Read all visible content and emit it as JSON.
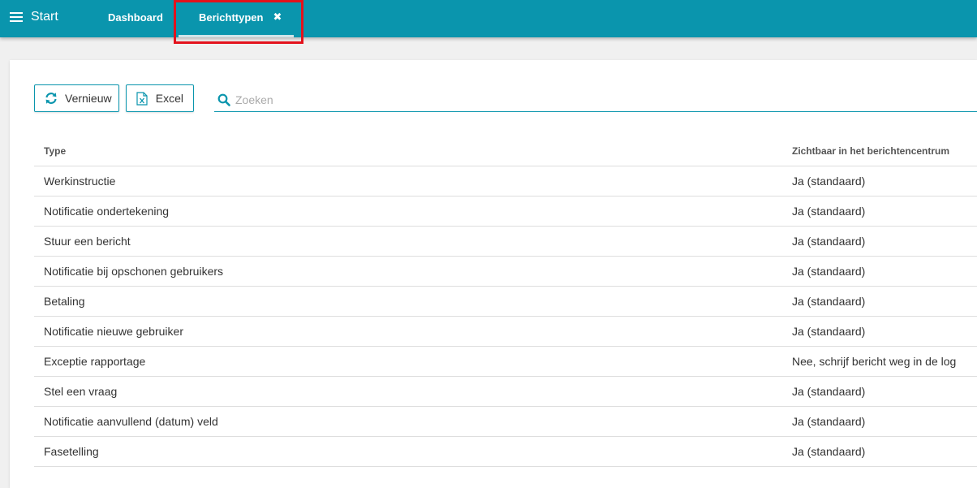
{
  "topbar": {
    "start_label": "Start",
    "tabs": [
      {
        "label": "Dashboard"
      },
      {
        "label": "Berichttypen",
        "close_icon": "close-icon"
      }
    ],
    "color": "#0a95ad"
  },
  "toolbar": {
    "refresh_label": "Vernieuw",
    "excel_label": "Excel",
    "search_placeholder": "Zoeken"
  },
  "table": {
    "columns": [
      "Type",
      "Zichtbaar in het berichtencentrum"
    ],
    "rows": [
      {
        "type": "Werkinstructie",
        "visible": "Ja (standaard)"
      },
      {
        "type": "Notificatie ondertekening",
        "visible": "Ja (standaard)"
      },
      {
        "type": "Stuur een bericht",
        "visible": "Ja (standaard)"
      },
      {
        "type": "Notificatie bij opschonen gebruikers",
        "visible": "Ja (standaard)"
      },
      {
        "type": "Betaling",
        "visible": "Ja (standaard)"
      },
      {
        "type": "Notificatie nieuwe gebruiker",
        "visible": "Ja (standaard)"
      },
      {
        "type": "Exceptie rapportage",
        "visible": "Nee, schrijf bericht weg in de log"
      },
      {
        "type": "Stel een vraag",
        "visible": "Ja (standaard)"
      },
      {
        "type": "Notificatie aanvullend (datum) veld",
        "visible": "Ja (standaard)"
      },
      {
        "type": "Fasetelling",
        "visible": "Ja (standaard)"
      }
    ]
  },
  "colors": {
    "accent": "#0a95ad",
    "highlight": "#e3121c"
  }
}
